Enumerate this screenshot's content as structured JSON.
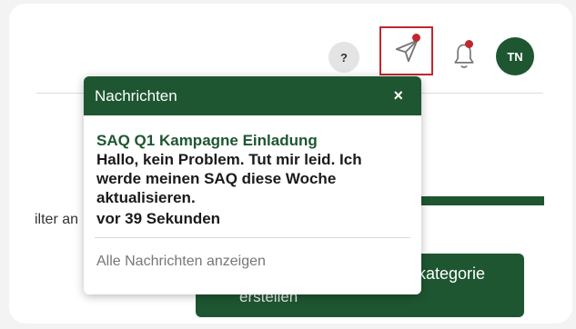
{
  "header": {
    "help_label": "?",
    "avatar_initials": "TN"
  },
  "background": {
    "filter_label": "ilter an",
    "category_button_label": "kategorie",
    "category_button_sub": "erstellen"
  },
  "notifications_popup": {
    "title": "Nachrichten",
    "close_label": "×",
    "message": {
      "subject": "SAQ Q1 Kampagne Einladung",
      "body_lines": [
        "Hallo, kein Problem. Tut mir leid. Ich",
        "werde meinen SAQ diese Woche",
        "aktualisieren."
      ],
      "time": "vor 39 Sekunden"
    },
    "view_all_label": "Alle Nachrichten anzeigen"
  },
  "colors": {
    "brand_green": "#1e5631",
    "alert_red": "#c0282d"
  },
  "icons": [
    "send-icon",
    "bell-icon"
  ]
}
